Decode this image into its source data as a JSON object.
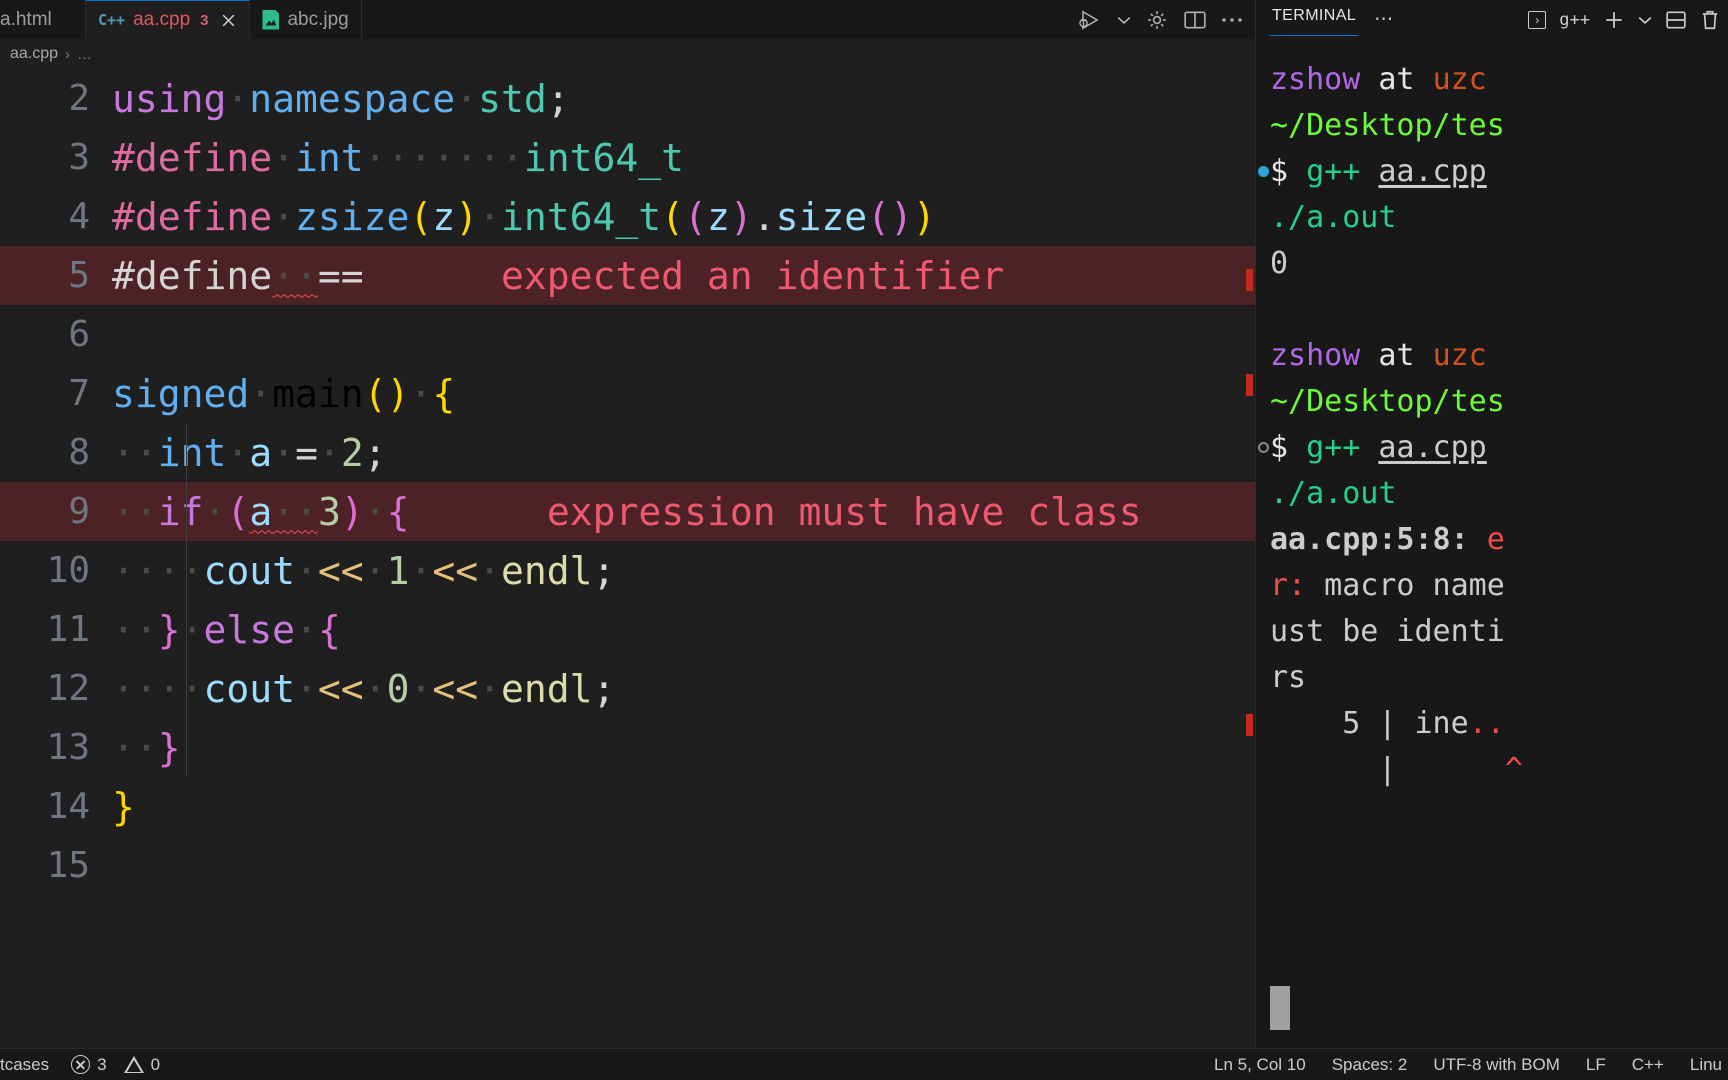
{
  "tabs": [
    {
      "label": "a.html",
      "icon": "html-file-icon",
      "active": false,
      "partial": true,
      "badge": "",
      "closable": false
    },
    {
      "label": "aa.cpp",
      "icon": "cpp-file-icon",
      "active": true,
      "partial": false,
      "badge": "3",
      "closable": true
    },
    {
      "label": "abc.jpg",
      "icon": "image-file-icon",
      "active": false,
      "partial": false,
      "badge": "",
      "closable": false
    }
  ],
  "editor_actions": [
    {
      "name": "run-and-debug-icon",
      "glyph": "run"
    },
    {
      "name": "chevron-down-icon",
      "glyph": "chevron"
    },
    {
      "name": "settings-gear-icon",
      "glyph": "gear"
    },
    {
      "name": "split-editor-icon",
      "glyph": "split"
    },
    {
      "name": "more-actions-icon",
      "glyph": "dots"
    }
  ],
  "breadcrumb": {
    "file": "aa.cpp",
    "separator": "›",
    "more": "…"
  },
  "editor": {
    "language": "C++",
    "lines": [
      {
        "num": "2",
        "error": false,
        "tokens": [
          {
            "t": "using",
            "c": "t-kw"
          },
          {
            "t": "·",
            "c": "t-ws"
          },
          {
            "t": "namespace",
            "c": "t-type"
          },
          {
            "t": "·",
            "c": "t-ws"
          },
          {
            "t": "std",
            "c": "t-green"
          },
          {
            "t": ";",
            "c": "t-plain"
          }
        ]
      },
      {
        "num": "3",
        "error": false,
        "tokens": [
          {
            "t": "#define",
            "c": "t-mac"
          },
          {
            "t": "·",
            "c": "t-ws"
          },
          {
            "t": "int",
            "c": "t-type"
          },
          {
            "t": "·······",
            "c": "t-ws"
          },
          {
            "t": "int64_t",
            "c": "t-green"
          }
        ]
      },
      {
        "num": "4",
        "error": false,
        "tokens": [
          {
            "t": "#define",
            "c": "t-mac"
          },
          {
            "t": "·",
            "c": "t-ws"
          },
          {
            "t": "zsize",
            "c": "t-type"
          },
          {
            "t": "(",
            "c": "t-paren1"
          },
          {
            "t": "z",
            "c": "t-var"
          },
          {
            "t": ")",
            "c": "t-paren1"
          },
          {
            "t": "·",
            "c": "t-ws"
          },
          {
            "t": "int64_t",
            "c": "t-green"
          },
          {
            "t": "(",
            "c": "t-paren1"
          },
          {
            "t": "(",
            "c": "t-paren2"
          },
          {
            "t": "z",
            "c": "t-var"
          },
          {
            "t": ")",
            "c": "t-paren2"
          },
          {
            "t": ".",
            "c": "t-plain"
          },
          {
            "t": "size",
            "c": "t-var"
          },
          {
            "t": "(",
            "c": "t-paren2"
          },
          {
            "t": ")",
            "c": "t-paren2"
          },
          {
            "t": ")",
            "c": "t-paren1"
          }
        ]
      },
      {
        "num": "5",
        "error": true,
        "error_message": "expected an identifier",
        "tokens": [
          {
            "t": "#define",
            "c": "t-plain"
          },
          {
            "t": "··",
            "c": "t-ws squig"
          },
          {
            "t": "==",
            "c": "t-plain"
          }
        ]
      },
      {
        "num": "6",
        "error": false,
        "tokens": []
      },
      {
        "num": "7",
        "error": false,
        "tokens": [
          {
            "t": "signed",
            "c": "t-type"
          },
          {
            "t": "·",
            "c": "t-ws"
          },
          {
            "t": "main",
            "c": "t-dcdcaa"
          },
          {
            "t": "(",
            "c": "t-paren1"
          },
          {
            "t": ")",
            "c": "t-paren1"
          },
          {
            "t": "·",
            "c": "t-ws"
          },
          {
            "t": "{",
            "c": "t-paren1"
          }
        ]
      },
      {
        "num": "8",
        "error": false,
        "tokens": [
          {
            "t": "··",
            "c": "t-ws"
          },
          {
            "t": "int",
            "c": "t-type"
          },
          {
            "t": "·",
            "c": "t-ws"
          },
          {
            "t": "a",
            "c": "t-var"
          },
          {
            "t": "·",
            "c": "t-ws"
          },
          {
            "t": "=",
            "c": "t-plain"
          },
          {
            "t": "·",
            "c": "t-ws"
          },
          {
            "t": "2",
            "c": "t-cnum"
          },
          {
            "t": ";",
            "c": "t-plain"
          }
        ]
      },
      {
        "num": "9",
        "error": true,
        "error_message": "expression must have class",
        "tokens": [
          {
            "t": "··",
            "c": "t-ws"
          },
          {
            "t": "if",
            "c": "t-kw"
          },
          {
            "t": "·",
            "c": "t-ws"
          },
          {
            "t": "(",
            "c": "t-paren2"
          },
          {
            "t": "a",
            "c": "t-var squig"
          },
          {
            "t": "··",
            "c": "t-ws squig"
          },
          {
            "t": "3",
            "c": "t-cnum"
          },
          {
            "t": ")",
            "c": "t-paren2"
          },
          {
            "t": "·",
            "c": "t-ws"
          },
          {
            "t": "{",
            "c": "t-paren2"
          }
        ]
      },
      {
        "num": "10",
        "error": false,
        "tokens": [
          {
            "t": "····",
            "c": "t-ws"
          },
          {
            "t": "cout",
            "c": "t-cout"
          },
          {
            "t": "·",
            "c": "t-ws"
          },
          {
            "t": "<<",
            "c": "t-shift"
          },
          {
            "t": "·",
            "c": "t-ws"
          },
          {
            "t": "1",
            "c": "t-cnum"
          },
          {
            "t": "·",
            "c": "t-ws"
          },
          {
            "t": "<<",
            "c": "t-shift"
          },
          {
            "t": "·",
            "c": "t-ws"
          },
          {
            "t": "endl",
            "c": "t-endl"
          },
          {
            "t": ";",
            "c": "t-plain"
          }
        ]
      },
      {
        "num": "11",
        "error": false,
        "tokens": [
          {
            "t": "··",
            "c": "t-ws"
          },
          {
            "t": "}",
            "c": "t-paren2"
          },
          {
            "t": "·",
            "c": "t-ws"
          },
          {
            "t": "else",
            "c": "t-kw"
          },
          {
            "t": "·",
            "c": "t-ws"
          },
          {
            "t": "{",
            "c": "t-paren2"
          }
        ]
      },
      {
        "num": "12",
        "error": false,
        "tokens": [
          {
            "t": "····",
            "c": "t-ws"
          },
          {
            "t": "cout",
            "c": "t-cout"
          },
          {
            "t": "·",
            "c": "t-ws"
          },
          {
            "t": "<<",
            "c": "t-shift"
          },
          {
            "t": "·",
            "c": "t-ws"
          },
          {
            "t": "0",
            "c": "t-cnum"
          },
          {
            "t": "·",
            "c": "t-ws"
          },
          {
            "t": "<<",
            "c": "t-shift"
          },
          {
            "t": "·",
            "c": "t-ws"
          },
          {
            "t": "endl",
            "c": "t-endl"
          },
          {
            "t": ";",
            "c": "t-plain"
          }
        ]
      },
      {
        "num": "13",
        "error": false,
        "tokens": [
          {
            "t": "··",
            "c": "t-ws"
          },
          {
            "t": "}",
            "c": "t-paren2"
          }
        ]
      },
      {
        "num": "14",
        "error": false,
        "tokens": [
          {
            "t": "}",
            "c": "t-paren1"
          }
        ]
      },
      {
        "num": "15",
        "error": false,
        "tokens": []
      }
    ]
  },
  "terminal": {
    "tab_label": "TERMINAL",
    "more_glyph": "⋯",
    "shell_name": "g++",
    "actions": [
      {
        "name": "new-terminal-icon",
        "glyph": "+"
      },
      {
        "name": "terminal-profile-chevron-icon",
        "glyph": "∨"
      },
      {
        "name": "split-terminal-icon",
        "glyph": "split"
      },
      {
        "name": "kill-terminal-icon",
        "glyph": "trash"
      }
    ],
    "lines": [
      {
        "marker": "none",
        "segs": [
          {
            "t": "zshow",
            "c": "c-purple"
          },
          {
            "t": " at ",
            "c": "c-white"
          },
          {
            "t": "uzc",
            "c": "c-orange"
          }
        ]
      },
      {
        "marker": "none",
        "segs": [
          {
            "t": "~/Desktop/tes",
            "c": "c-lgreen"
          }
        ]
      },
      {
        "marker": "blue",
        "segs": [
          {
            "t": "$ ",
            "c": "c-white"
          },
          {
            "t": "g++ ",
            "c": "c-green"
          },
          {
            "t": "aa.cpp",
            "c": "c-gray u"
          }
        ]
      },
      {
        "marker": "none",
        "segs": [
          {
            "t": "./a.out",
            "c": "c-green"
          }
        ]
      },
      {
        "marker": "none",
        "segs": [
          {
            "t": "0",
            "c": "c-gray"
          }
        ]
      },
      {
        "marker": "none",
        "segs": [
          {
            "t": "",
            "c": "c-gray"
          }
        ]
      },
      {
        "marker": "none",
        "segs": [
          {
            "t": "zshow",
            "c": "c-purple"
          },
          {
            "t": " at ",
            "c": "c-white"
          },
          {
            "t": "uzc",
            "c": "c-orange"
          }
        ]
      },
      {
        "marker": "none",
        "segs": [
          {
            "t": "~/Desktop/tes",
            "c": "c-lgreen"
          }
        ]
      },
      {
        "marker": "gray",
        "segs": [
          {
            "t": "$ ",
            "c": "c-white"
          },
          {
            "t": "g++ ",
            "c": "c-green"
          },
          {
            "t": "aa.cpp",
            "c": "c-gray u"
          }
        ]
      },
      {
        "marker": "none",
        "segs": [
          {
            "t": "./a.out",
            "c": "c-green"
          }
        ]
      },
      {
        "marker": "none",
        "segs": [
          {
            "t": "aa.cpp:5:8: ",
            "c": "c-gray bold"
          },
          {
            "t": "e",
            "c": "c-red"
          }
        ]
      },
      {
        "marker": "none",
        "segs": [
          {
            "t": "r:",
            "c": "c-red"
          },
          {
            "t": " macro name",
            "c": "c-gray"
          }
        ]
      },
      {
        "marker": "none",
        "segs": [
          {
            "t": "ust be identi",
            "c": "c-gray"
          }
        ]
      },
      {
        "marker": "none",
        "segs": [
          {
            "t": "rs",
            "c": "c-gray"
          }
        ]
      },
      {
        "marker": "none",
        "segs": [
          {
            "t": "    5 | ine",
            "c": "c-gray"
          },
          {
            "t": "..",
            "c": "c-red"
          }
        ]
      },
      {
        "marker": "none",
        "segs": [
          {
            "t": "      |      ",
            "c": "c-gray"
          },
          {
            "t": "^",
            "c": "c-red"
          }
        ]
      }
    ]
  },
  "statusbar": {
    "left": [
      {
        "name": "folder-label",
        "text": "tcases"
      },
      {
        "name": "problems-errors",
        "text": "3"
      },
      {
        "name": "problems-warnings",
        "text": "0"
      }
    ],
    "right": [
      {
        "name": "cursor-position",
        "text": "Ln 5, Col 10"
      },
      {
        "name": "indentation",
        "text": "Spaces: 2"
      },
      {
        "name": "encoding",
        "text": "UTF-8 with BOM"
      },
      {
        "name": "eol",
        "text": "LF"
      },
      {
        "name": "language-mode",
        "text": "C++"
      },
      {
        "name": "remote-platform",
        "text": "Linu"
      }
    ]
  },
  "colors": {
    "accent": "#0078d4",
    "error": "#f14c4c",
    "error_line_bg": "#4d2226",
    "editor_bg": "#1f1f1f",
    "chrome_bg": "#181818"
  }
}
